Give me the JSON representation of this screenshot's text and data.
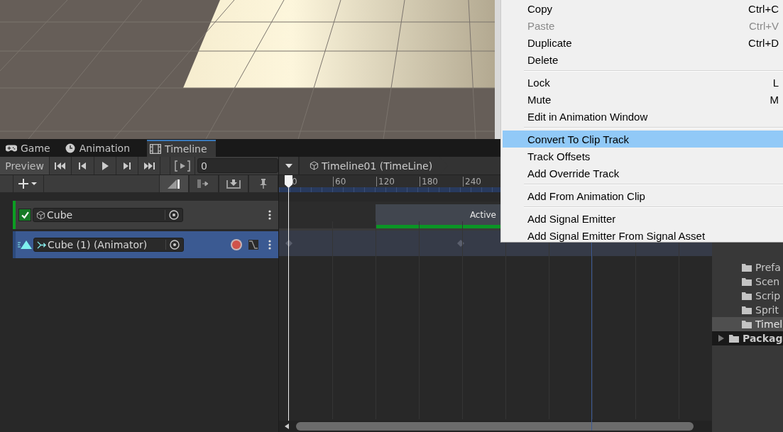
{
  "tabs": [
    {
      "kind": "game",
      "label": "Game",
      "selected": false
    },
    {
      "kind": "animation",
      "label": "Animation",
      "selected": false
    },
    {
      "kind": "timeline",
      "label": "Timeline",
      "selected": true
    }
  ],
  "toolbar": {
    "preview": "Preview",
    "frame": "0",
    "breadcrumb": "Timeline01 (TimeLine)"
  },
  "ruler": {
    "ticks": [
      "0",
      "60",
      "120",
      "180",
      "240"
    ]
  },
  "tracks": [
    {
      "kind": "activation",
      "name": "Cube",
      "checked": true,
      "selected": false,
      "clip": "Active"
    },
    {
      "kind": "animation",
      "name": "Cube (1) (Animator)",
      "selected": true
    }
  ],
  "context_menu": {
    "groups": [
      [
        {
          "label": "Copy",
          "shortcut": "Ctrl+C",
          "disabled": false,
          "selected": false
        },
        {
          "label": "Paste",
          "shortcut": "Ctrl+V",
          "disabled": true,
          "selected": false
        },
        {
          "label": "Duplicate",
          "shortcut": "Ctrl+D",
          "disabled": false,
          "selected": false
        },
        {
          "label": "Delete",
          "disabled": false,
          "selected": false
        }
      ],
      [
        {
          "label": "Lock",
          "shortcut": "L",
          "disabled": false,
          "selected": false
        },
        {
          "label": "Mute",
          "shortcut": "M",
          "disabled": false,
          "selected": false
        },
        {
          "label": "Edit in Animation Window",
          "disabled": false,
          "selected": false
        }
      ],
      [
        {
          "label": "Convert To Clip Track",
          "disabled": false,
          "selected": true
        },
        {
          "label": "Track Offsets",
          "disabled": false,
          "selected": false
        },
        {
          "label": "Add Override Track",
          "disabled": false,
          "selected": false
        }
      ],
      [
        {
          "label": "Add From Animation Clip",
          "disabled": false,
          "selected": false
        }
      ],
      [
        {
          "label": "Add Signal Emitter",
          "disabled": false,
          "selected": false
        },
        {
          "label": "Add Signal Emitter From Signal Asset",
          "disabled": false,
          "selected": false
        }
      ]
    ]
  },
  "project": {
    "items": [
      {
        "kind": "folder",
        "label": "Prefa",
        "selected": false
      },
      {
        "kind": "folder",
        "label": "Scen",
        "selected": false
      },
      {
        "kind": "folder",
        "label": "Scrip",
        "selected": false
      },
      {
        "kind": "folder",
        "label": "Sprit",
        "selected": false
      },
      {
        "kind": "folder",
        "label": "Timel",
        "selected": true
      },
      {
        "kind": "root",
        "label": "Packag",
        "selected": false
      }
    ]
  }
}
